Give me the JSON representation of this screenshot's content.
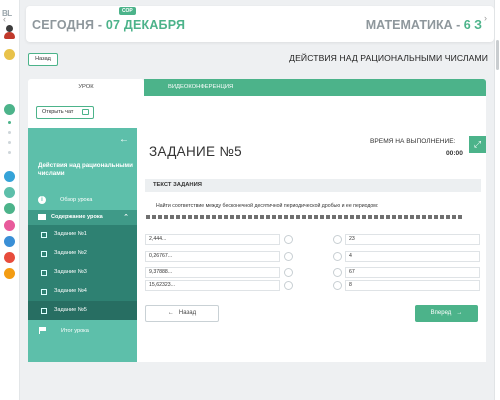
{
  "rail": {
    "logo": "BL",
    "colors": [
      "#e8c24a",
      "#e0a100",
      "#4cb38a",
      "#35a3d8",
      "#5dbfaa",
      "#e85a9b",
      "#3a8fd6",
      "#f39c12",
      "#e74c3c"
    ]
  },
  "header": {
    "date_prefix": "СЕГОДНЯ - ",
    "date_value": "07 ДЕКАБРЯ",
    "badge": "СОР",
    "subject_prefix": "МАТЕМАТИКА - ",
    "subject_class": "6 З"
  },
  "nav": {
    "back_label": "Назад",
    "lesson_title": "ДЕЙСТВИЯ НАД РАЦИОНАЛЬНЫМИ ЧИСЛАМИ"
  },
  "tabs": {
    "lesson": "УРОК",
    "video": "ВИДЕОКОНФЕРЕНЦИЯ"
  },
  "chat_button": "Открыть чат",
  "sidebar": {
    "title": "Действия над рациональными числами",
    "overview": "Обзор урока",
    "content_label": "Содержание урока",
    "tasks": [
      "Задание №1",
      "Задание №2",
      "Задание №3",
      "Задание №4",
      "Задание №5"
    ],
    "summary": "Итог урока"
  },
  "task": {
    "title": "ЗАДАНИЕ №5",
    "time_label": "ВРЕМЯ НА ВЫПОЛНЕНИЕ:",
    "time_value": "00:00",
    "text_header": "ТЕКСТ ЗАДАНИЯ",
    "instruction": "Найти соответствие между бесконечной десятичной периодической дробью и ее периодом:",
    "left_items": [
      "2,444...",
      "0,26767...",
      "9,37888...",
      "15,62323..."
    ],
    "right_items": [
      "23",
      "4",
      "67",
      "8"
    ]
  },
  "buttons": {
    "prev": "Назад",
    "next": "Вперед"
  }
}
